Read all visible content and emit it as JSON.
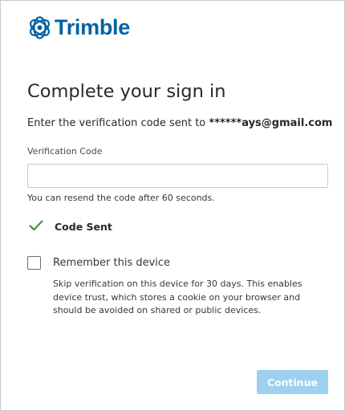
{
  "brand": {
    "name": "Trimble",
    "logo_icon": "trimble-globe-icon",
    "color": "#0063a3"
  },
  "page": {
    "title": "Complete your sign in",
    "instruction_prefix": "Enter the verification code sent to",
    "masked_email": "******ays@gmail.com"
  },
  "verification": {
    "label": "Verification Code",
    "value": "",
    "placeholder": "",
    "resend_text": "You can resend the code after 60 seconds."
  },
  "status": {
    "icon": "checkmark-icon",
    "label": "Code Sent",
    "color": "#3a9a35"
  },
  "remember": {
    "label": "Remember this device",
    "checked": false,
    "help": "Skip verification on this device for 30 days. This enables device trust, which stores a cookie on your browser and should be avoided on shared or public devices."
  },
  "actions": {
    "continue_label": "Continue",
    "continue_enabled": false,
    "continue_color": "#9ed0ef"
  }
}
